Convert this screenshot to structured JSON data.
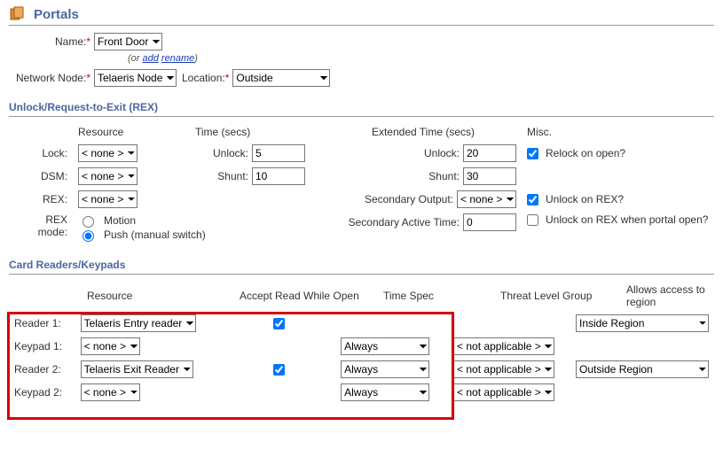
{
  "header": {
    "title": "Portals"
  },
  "basic": {
    "name_label": "Name:",
    "name_value": "Front Door",
    "hint_prefix": "(or ",
    "add_link": "add",
    "hint_mid": "   ",
    "rename_link": "rename",
    "hint_suffix": ")",
    "network_node_label": "Network Node:",
    "network_node_value": "Telaeris Node",
    "location_label": "Location:",
    "location_value": "Outside"
  },
  "rex": {
    "section_title": "Unlock/Request-to-Exit (REX)",
    "col_resource": "Resource",
    "col_time": "Time (secs)",
    "col_xtime": "Extended Time (secs)",
    "col_misc": "Misc.",
    "lock_label": "Lock:",
    "lock_value": "< none >",
    "dsm_label": "DSM:",
    "dsm_value": "< none >",
    "rex_label": "REX:",
    "rex_value": "< none >",
    "unlock_label": "Unlock:",
    "unlock_value": "5",
    "shunt_label": "Shunt:",
    "shunt_value": "10",
    "xunlock_label": "Unlock:",
    "xunlock_value": "20",
    "xshunt_label": "Shunt:",
    "xshunt_value": "30",
    "secondary_output_label": "Secondary Output:",
    "secondary_output_value": "< none >",
    "secondary_active_label": "Secondary Active Time:",
    "secondary_active_value": "0",
    "relock_label": "Relock on open?",
    "relock_checked": true,
    "unlock_on_rex_label": "Unlock on REX?",
    "unlock_on_rex_checked": true,
    "unlock_on_rex_open_label": "Unlock on REX when portal open?",
    "unlock_on_rex_open_checked": false,
    "rex_mode_label": "REX mode:",
    "rex_mode_motion": "Motion",
    "rex_mode_push": "Push (manual switch)"
  },
  "readers": {
    "section_title": "Card Readers/Keypads",
    "col_resource": "Resource",
    "col_accept": "Accept Read While Open",
    "col_timespec": "Time Spec",
    "col_threat": "Threat Level Group",
    "col_region": "Allows access to region",
    "rows": [
      {
        "label": "Reader 1:",
        "resource": "Telaeris Entry reader",
        "accept": true,
        "timespec": "",
        "threat": "",
        "region": "Inside Region"
      },
      {
        "label": "Keypad 1:",
        "resource": "< none >",
        "accept": null,
        "timespec": "Always",
        "threat": "< not applicable >",
        "region": ""
      },
      {
        "label": "Reader 2:",
        "resource": "Telaeris Exit Reader",
        "accept": true,
        "timespec": "Always",
        "threat": "< not applicable >",
        "region": "Outside Region"
      },
      {
        "label": "Keypad 2:",
        "resource": "< none >",
        "accept": null,
        "timespec": "Always",
        "threat": "< not applicable >",
        "region": ""
      }
    ]
  }
}
